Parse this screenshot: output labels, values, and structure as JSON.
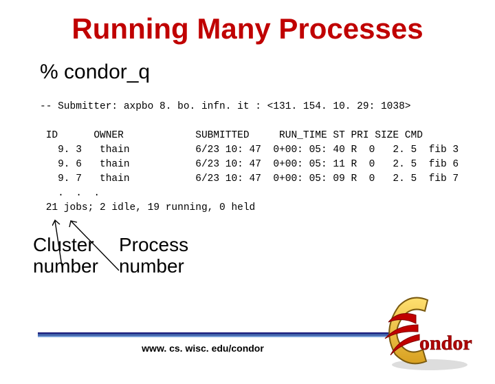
{
  "title": "Running Many Processes",
  "command": "% condor_q",
  "submitter_line": "-- Submitter: axpbo 8. bo. infn. it : <131. 154. 10. 29: 1038>",
  "header": " ID      OWNER            SUBMITTED     RUN_TIME ST PRI SIZE CMD",
  "rows": [
    "   9. 3   thain           6/23 10: 47  0+00: 05: 40 R  0   2. 5  fib 3",
    "   9. 6   thain           6/23 10: 47  0+00: 05: 11 R  0   2. 5  fib 6",
    "   9. 7   thain           6/23 10: 47  0+00: 05: 09 R  0   2. 5  fib 7"
  ],
  "dots": "   .  .  .",
  "summary": " 21 jobs; 2 idle, 19 running, 0 held",
  "label_cluster": "Cluster\nnumber",
  "label_process": "Process\nnumber",
  "url": "www. cs. wisc. edu/condor",
  "logo_text": "ondor"
}
